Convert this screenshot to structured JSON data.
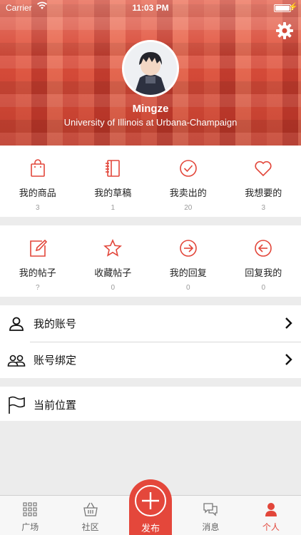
{
  "status_bar": {
    "carrier": "Carrier",
    "time": "11:03 PM"
  },
  "profile": {
    "name": "Mingze",
    "school": "University of Illinois at Urbana-Champaign"
  },
  "grid_top": [
    {
      "label": "我的商品",
      "count": "3",
      "icon": "shopping-bag-icon"
    },
    {
      "label": "我的草稿",
      "count": "1",
      "icon": "notebook-icon"
    },
    {
      "label": "我卖出的",
      "count": "20",
      "icon": "check-circle-icon"
    },
    {
      "label": "我想要的",
      "count": "3",
      "icon": "heart-icon"
    }
  ],
  "grid_bottom": [
    {
      "label": "我的帖子",
      "count": "?",
      "icon": "edit-icon"
    },
    {
      "label": "收藏帖子",
      "count": "0",
      "icon": "star-icon"
    },
    {
      "label": "我的回复",
      "count": "0",
      "icon": "arrow-right-circle-icon"
    },
    {
      "label": "回复我的",
      "count": "0",
      "icon": "arrow-left-circle-icon"
    }
  ],
  "list": {
    "my_account": "我的账号",
    "account_binding": "账号绑定",
    "current_location": "当前位置"
  },
  "tabbar": {
    "plaza": "广场",
    "community": "社区",
    "publish": "发布",
    "messages": "消息",
    "personal": "个人"
  },
  "colors": {
    "accent": "#e2463a",
    "header": "#d44a38"
  }
}
